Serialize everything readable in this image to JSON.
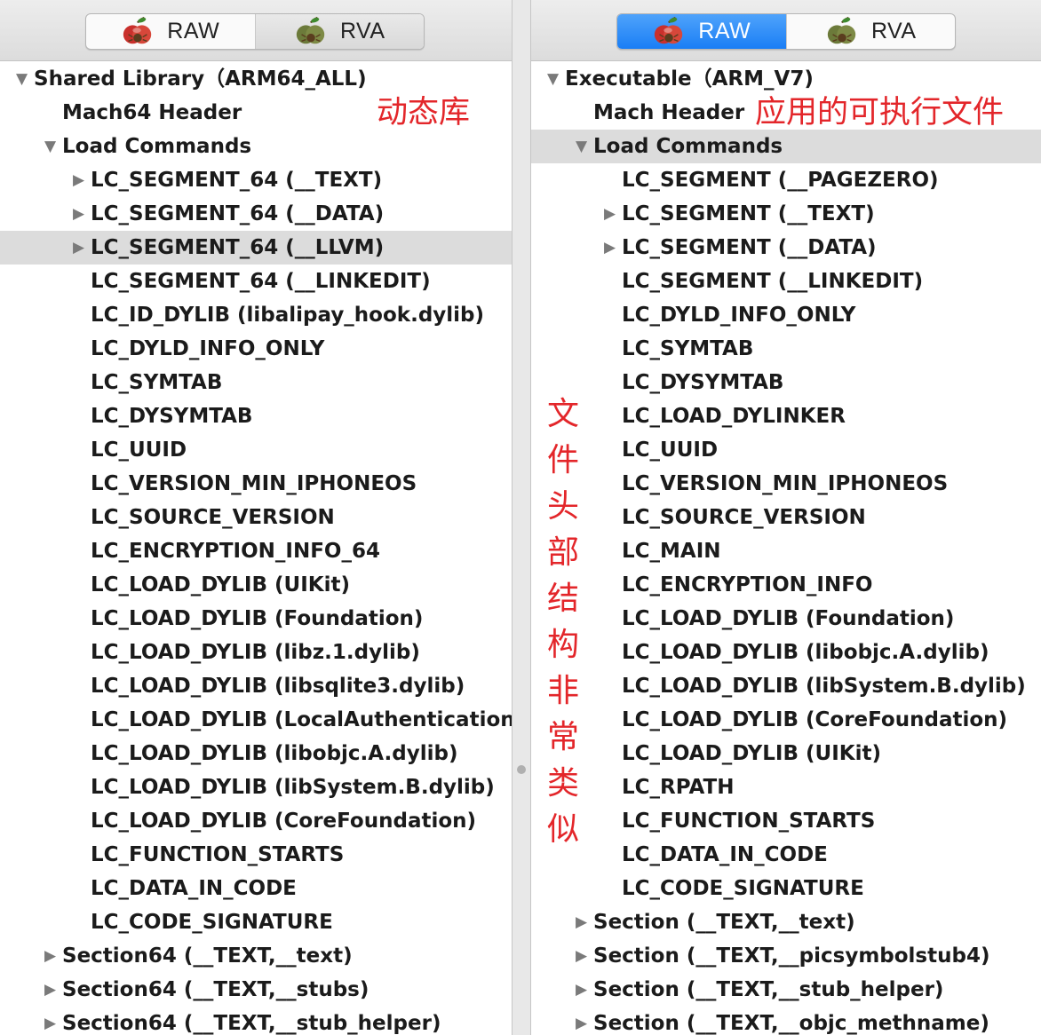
{
  "left": {
    "raw_label": "RAW",
    "rva_label": "RVA",
    "annotation": "动态库",
    "rows": [
      {
        "text": "Shared Library（ARM64_ALL)",
        "indent": 0,
        "tri": "down"
      },
      {
        "text": "Mach64 Header",
        "indent": 1,
        "tri": ""
      },
      {
        "text": "Load Commands",
        "indent": 1,
        "tri": "down"
      },
      {
        "text": "LC_SEGMENT_64 (__TEXT)",
        "indent": 2,
        "tri": "right"
      },
      {
        "text": "LC_SEGMENT_64 (__DATA)",
        "indent": 2,
        "tri": "right"
      },
      {
        "text": "LC_SEGMENT_64 (__LLVM)",
        "indent": 2,
        "tri": "right",
        "selected": true
      },
      {
        "text": "LC_SEGMENT_64 (__LINKEDIT)",
        "indent": 2,
        "tri": ""
      },
      {
        "text": "LC_ID_DYLIB (libalipay_hook.dylib)",
        "indent": 2,
        "tri": ""
      },
      {
        "text": "LC_DYLD_INFO_ONLY",
        "indent": 2,
        "tri": ""
      },
      {
        "text": "LC_SYMTAB",
        "indent": 2,
        "tri": ""
      },
      {
        "text": "LC_DYSYMTAB",
        "indent": 2,
        "tri": ""
      },
      {
        "text": "LC_UUID",
        "indent": 2,
        "tri": ""
      },
      {
        "text": "LC_VERSION_MIN_IPHONEOS",
        "indent": 2,
        "tri": ""
      },
      {
        "text": "LC_SOURCE_VERSION",
        "indent": 2,
        "tri": ""
      },
      {
        "text": "LC_ENCRYPTION_INFO_64",
        "indent": 2,
        "tri": ""
      },
      {
        "text": "LC_LOAD_DYLIB (UIKit)",
        "indent": 2,
        "tri": ""
      },
      {
        "text": "LC_LOAD_DYLIB (Foundation)",
        "indent": 2,
        "tri": ""
      },
      {
        "text": "LC_LOAD_DYLIB (libz.1.dylib)",
        "indent": 2,
        "tri": ""
      },
      {
        "text": "LC_LOAD_DYLIB (libsqlite3.dylib)",
        "indent": 2,
        "tri": ""
      },
      {
        "text": "LC_LOAD_DYLIB (LocalAuthentication)",
        "indent": 2,
        "tri": ""
      },
      {
        "text": "LC_LOAD_DYLIB (libobjc.A.dylib)",
        "indent": 2,
        "tri": ""
      },
      {
        "text": "LC_LOAD_DYLIB (libSystem.B.dylib)",
        "indent": 2,
        "tri": ""
      },
      {
        "text": "LC_LOAD_DYLIB (CoreFoundation)",
        "indent": 2,
        "tri": ""
      },
      {
        "text": "LC_FUNCTION_STARTS",
        "indent": 2,
        "tri": ""
      },
      {
        "text": "LC_DATA_IN_CODE",
        "indent": 2,
        "tri": ""
      },
      {
        "text": "LC_CODE_SIGNATURE",
        "indent": 2,
        "tri": ""
      },
      {
        "text": "Section64 (__TEXT,__text)",
        "indent": 1,
        "tri": "right"
      },
      {
        "text": "Section64 (__TEXT,__stubs)",
        "indent": 1,
        "tri": "right"
      },
      {
        "text": "Section64 (__TEXT,__stub_helper)",
        "indent": 1,
        "tri": "right"
      }
    ]
  },
  "right": {
    "raw_label": "RAW",
    "rva_label": "RVA",
    "annotation": "应用的可执行文件",
    "vertical_annotation": [
      "文",
      "件",
      "头",
      "部",
      "结",
      "构",
      "非",
      "常",
      "类",
      "似"
    ],
    "rows": [
      {
        "text": "Executable（ARM_V7)",
        "indent": 0,
        "tri": "down"
      },
      {
        "text": "Mach Header",
        "indent": 1,
        "tri": ""
      },
      {
        "text": "Load Commands",
        "indent": 1,
        "tri": "down",
        "selected": true
      },
      {
        "text": "LC_SEGMENT (__PAGEZERO)",
        "indent": 2,
        "tri": ""
      },
      {
        "text": "LC_SEGMENT (__TEXT)",
        "indent": 2,
        "tri": "right"
      },
      {
        "text": "LC_SEGMENT (__DATA)",
        "indent": 2,
        "tri": "right"
      },
      {
        "text": "LC_SEGMENT (__LINKEDIT)",
        "indent": 2,
        "tri": ""
      },
      {
        "text": "LC_DYLD_INFO_ONLY",
        "indent": 2,
        "tri": ""
      },
      {
        "text": "LC_SYMTAB",
        "indent": 2,
        "tri": ""
      },
      {
        "text": "LC_DYSYMTAB",
        "indent": 2,
        "tri": ""
      },
      {
        "text": "LC_LOAD_DYLINKER",
        "indent": 2,
        "tri": ""
      },
      {
        "text": "LC_UUID",
        "indent": 2,
        "tri": ""
      },
      {
        "text": "LC_VERSION_MIN_IPHONEOS",
        "indent": 2,
        "tri": ""
      },
      {
        "text": "LC_SOURCE_VERSION",
        "indent": 2,
        "tri": ""
      },
      {
        "text": "LC_MAIN",
        "indent": 2,
        "tri": ""
      },
      {
        "text": "LC_ENCRYPTION_INFO",
        "indent": 2,
        "tri": ""
      },
      {
        "text": "LC_LOAD_DYLIB (Foundation)",
        "indent": 2,
        "tri": ""
      },
      {
        "text": "LC_LOAD_DYLIB (libobjc.A.dylib)",
        "indent": 2,
        "tri": ""
      },
      {
        "text": "LC_LOAD_DYLIB (libSystem.B.dylib)",
        "indent": 2,
        "tri": ""
      },
      {
        "text": "LC_LOAD_DYLIB (CoreFoundation)",
        "indent": 2,
        "tri": ""
      },
      {
        "text": "LC_LOAD_DYLIB (UIKit)",
        "indent": 2,
        "tri": ""
      },
      {
        "text": "LC_RPATH",
        "indent": 2,
        "tri": ""
      },
      {
        "text": "LC_FUNCTION_STARTS",
        "indent": 2,
        "tri": ""
      },
      {
        "text": "LC_DATA_IN_CODE",
        "indent": 2,
        "tri": ""
      },
      {
        "text": "LC_CODE_SIGNATURE",
        "indent": 2,
        "tri": ""
      },
      {
        "text": "Section (__TEXT,__text)",
        "indent": 1,
        "tri": "right"
      },
      {
        "text": "Section (__TEXT,__picsymbolstub4)",
        "indent": 1,
        "tri": "right"
      },
      {
        "text": "Section (__TEXT,__stub_helper)",
        "indent": 1,
        "tri": "right"
      },
      {
        "text": "Section (__TEXT,__objc_methname)",
        "indent": 1,
        "tri": "right"
      }
    ]
  },
  "icons": {
    "raw": "apple-bug-red-icon",
    "rva": "apple-bug-green-icon",
    "expanded": "disclosure-down-icon",
    "collapsed": "disclosure-right-icon"
  },
  "colors": {
    "annotation": "#e3262a",
    "selected_row": "#dcdcdc",
    "active_segment": "#1a7ef5"
  }
}
